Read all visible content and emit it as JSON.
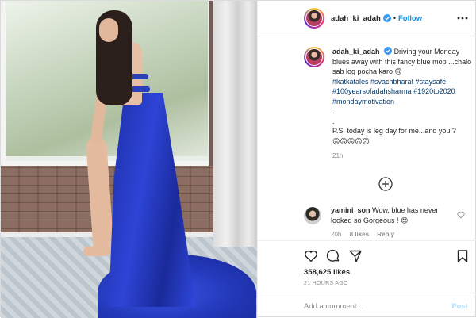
{
  "post": {
    "image_alt": "Woman in a blue backless gown with a long train standing by a window",
    "header": {
      "username": "adah_ki_adah",
      "verified": true,
      "separator": "•",
      "follow_label": "Follow",
      "more_icon": "more-horizontal-icon"
    },
    "caption": {
      "username": "adah_ki_adah",
      "text": "Driving your Monday blues away with this fancy blue mop ...chalo sab log pocha karo 🙃",
      "hashtags": "#katkatales #svachbharat #staysafe #100yearsofadahsharma #1920to2020 #mondaymotivation",
      "dots": [
        ".",
        "."
      ],
      "ps": "P.S. today is leg day for me...and you ?",
      "emojis": "🙃🙃🙃🙃🙃",
      "time": "21h"
    },
    "load_more_icon": "plus-circle-icon",
    "comments": [
      {
        "username": "yamini_son",
        "text": "Wow, blue has never looked so Gorgeous ! 😍",
        "time": "20h",
        "likes": "8 likes",
        "reply": "Reply"
      }
    ],
    "actions": {
      "like_icon": "heart-icon",
      "comment_icon": "comment-icon",
      "share_icon": "share-icon",
      "save_icon": "bookmark-icon"
    },
    "likes": "358,625 likes",
    "posted_ago": "21 HOURS AGO",
    "add_comment": {
      "placeholder": "Add a comment...",
      "post_label": "Post"
    }
  },
  "colors": {
    "accent": "#0095f6",
    "link": "#00376b",
    "muted": "#8e8e8e",
    "post_disabled": "#b2dffc",
    "dress_blue": "#2d44d6"
  }
}
